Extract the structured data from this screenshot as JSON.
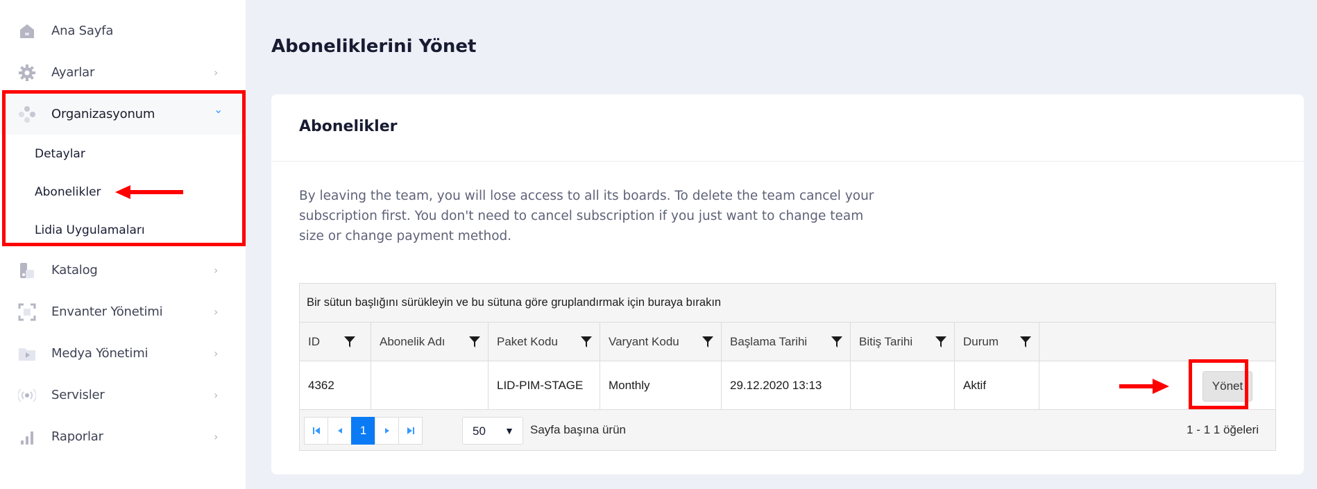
{
  "sidebar": {
    "items": [
      {
        "label": "Ana Sayfa",
        "icon": "home-icon",
        "chevron": ""
      },
      {
        "label": "Ayarlar",
        "icon": "gear-icon",
        "chevron": "›"
      },
      {
        "label": "Organizasyonum",
        "icon": "organization-icon",
        "chevron": "⌄"
      },
      {
        "label": "Katalog",
        "icon": "catalog-icon",
        "chevron": "›"
      },
      {
        "label": "Envanter Yönetimi",
        "icon": "inventory-icon",
        "chevron": "›"
      },
      {
        "label": "Medya Yönetimi",
        "icon": "media-folder-icon",
        "chevron": "›"
      },
      {
        "label": "Servisler",
        "icon": "broadcast-icon",
        "chevron": "›"
      },
      {
        "label": "Raporlar",
        "icon": "bar-chart-icon",
        "chevron": "›"
      }
    ],
    "subitems": [
      "Detaylar",
      "Abonelikler",
      "Lidia Uygulamaları"
    ]
  },
  "page": {
    "title": "Aboneliklerini Yönet"
  },
  "card": {
    "title": "Abonelikler",
    "description": "By leaving the team, you will lose access to all its boards. To delete the team cancel your subscription first. You don't need to cancel subscription if you just want to change team size or change payment method."
  },
  "grid": {
    "group_panel": "Bir sütun başlığını sürükleyin ve bu sütuna göre gruplandırmak için buraya bırakın",
    "columns": [
      "ID",
      "Abonelik Adı",
      "Paket Kodu",
      "Varyant Kodu",
      "Başlama Tarihi",
      "Bitiş Tarihi",
      "Durum",
      ""
    ],
    "rows": [
      {
        "id": "4362",
        "name": "",
        "package": "LID-PIM-STAGE",
        "variant": "Monthly",
        "start": "29.12.2020 13:13",
        "end": "",
        "status": "Aktif",
        "action": "Yönet"
      }
    ],
    "pager": {
      "current_page": "1",
      "page_size": "50",
      "page_size_label": "Sayfa başına ürün",
      "info": "1 - 1 1 öğeleri"
    }
  },
  "colors": {
    "accent": "#3699ff",
    "page_current": "#0a7bf5",
    "annotation": "#ff0000",
    "background": "#eef0f7"
  }
}
